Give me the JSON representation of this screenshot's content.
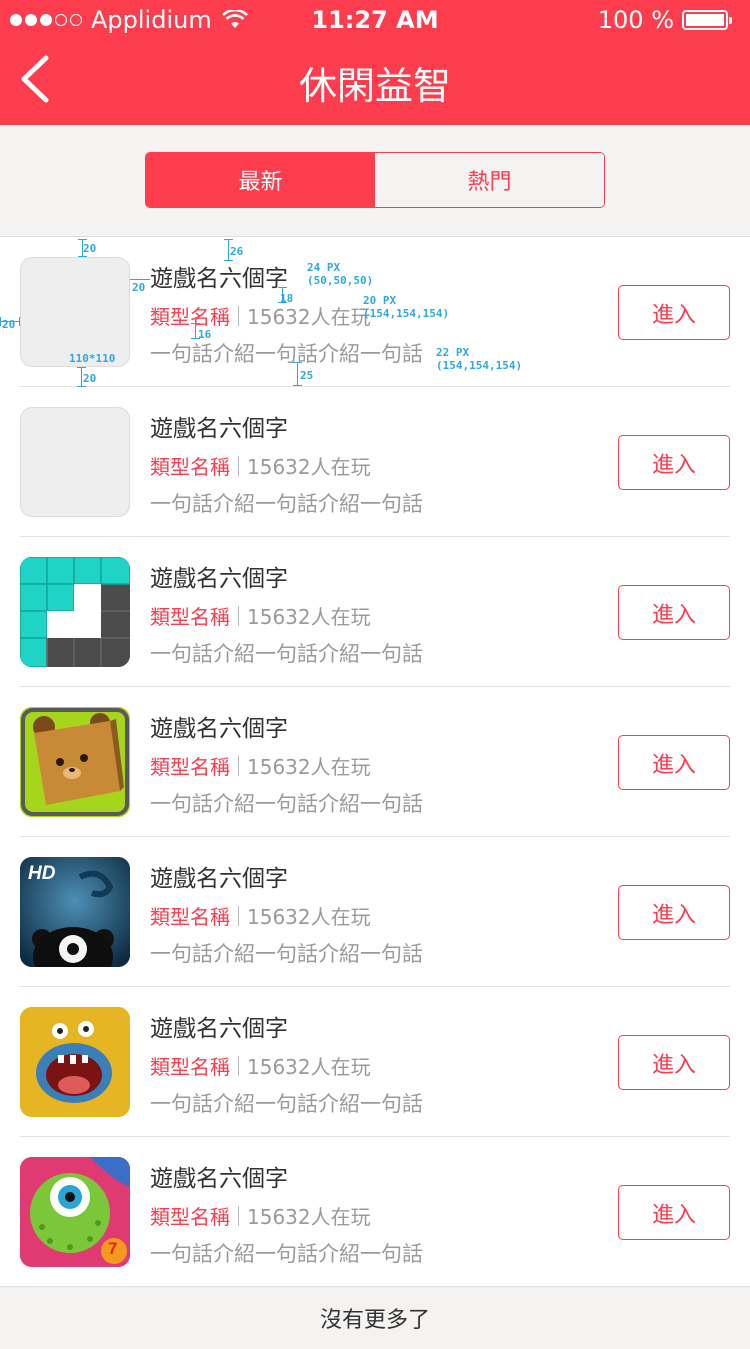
{
  "status_bar": {
    "carrier": "Applidium",
    "time": "11:27 AM",
    "battery_text": "100 %",
    "signal_icon": "signal-dots-icon",
    "wifi_icon": "wifi-icon",
    "battery_icon": "battery-icon"
  },
  "nav": {
    "title": "休閑益智",
    "back_icon": "chevron-left-icon"
  },
  "tabs": [
    {
      "label": "最新",
      "selected": true
    },
    {
      "label": "熱門",
      "selected": false
    }
  ],
  "games": [
    {
      "name": "遊戲名六個字",
      "genre": "類型名稱",
      "players": "15632人在玩",
      "desc": "一句話介紹一句話介紹一句話",
      "button": "進入",
      "icon": "placeholder-icon"
    },
    {
      "name": "遊戲名六個字",
      "genre": "類型名稱",
      "players": "15632人在玩",
      "desc": "一句話介紹一句話介紹一句話",
      "button": "進入",
      "icon": "placeholder-icon"
    },
    {
      "name": "遊戲名六個字",
      "genre": "類型名稱",
      "players": "15632人在玩",
      "desc": "一句話介紹一句話介紹一句話",
      "button": "進入",
      "icon": "block-puzzle-icon"
    },
    {
      "name": "遊戲名六個字",
      "genre": "類型名稱",
      "players": "15632人在玩",
      "desc": "一句話介紹一句話介紹一句話",
      "button": "進入",
      "icon": "bear-cube-icon"
    },
    {
      "name": "遊戲名六個字",
      "genre": "類型名稱",
      "players": "15632人在玩",
      "desc": "一句話介紹一句話介紹一句話",
      "button": "進入",
      "icon": "hd-monster-icon",
      "icon_text": "HD"
    },
    {
      "name": "遊戲名六個字",
      "genre": "類型名稱",
      "players": "15632人在玩",
      "desc": "一句話介紹一句話介紹一句話",
      "button": "進入",
      "icon": "yellow-monster-icon"
    },
    {
      "name": "遊戲名六個字",
      "genre": "類型名稱",
      "players": "15632人在玩",
      "desc": "一句話介紹一句話介紹一句話",
      "button": "進入",
      "icon": "green-monster-icon",
      "icon_text": "7"
    }
  ],
  "annotations": {
    "top_gap": "20",
    "name_top": "26",
    "name_spec": "24 PX",
    "name_color": "(50,50,50)",
    "icon_gap": "20",
    "meta_gap": "18",
    "meta_spec": "20 PX",
    "meta_color": "(154,154,154)",
    "left_gap": "20",
    "desc_gap": "16",
    "desc_spec": "22 PX",
    "desc_color": "(154,154,154)",
    "icon_size": "110*110",
    "bottom_gap": "20",
    "desc_bottom": "25"
  },
  "footer": {
    "text": "沒有更多了"
  },
  "colors": {
    "accent": "#fd3c4e",
    "background": "#f4f3f1",
    "text_dark": "#323232",
    "text_gray": "#9a9a9a",
    "annotation": "#2fa8de"
  }
}
